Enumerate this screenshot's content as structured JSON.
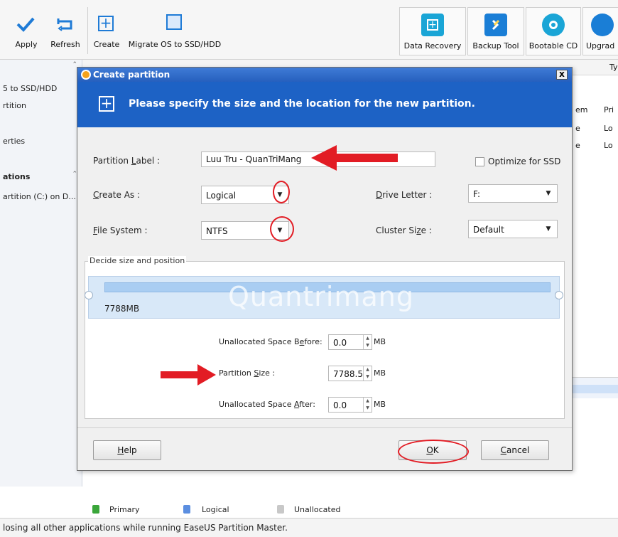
{
  "toolbar": {
    "apply": "Apply",
    "refresh": "Refresh",
    "create": "Create",
    "migrate": "Migrate OS to SSD/HDD",
    "data_recovery": "Data Recovery",
    "backup_tool": "Backup Tool",
    "bootable_cd": "Bootable CD",
    "upgrade": "Upgrad"
  },
  "sidebar": {
    "items": [
      {
        "label": "5 to SSD/HDD"
      },
      {
        "label": "rtition"
      },
      {
        "label": "erties"
      },
      {
        "label": "ations"
      },
      {
        "label": "artition (C:) on D..."
      }
    ]
  },
  "background_list": {
    "header_ty": "Ty",
    "col_em": "em",
    "rows": [
      {
        "a": "",
        "b": "Pri"
      },
      {
        "a": "e",
        "b": "Lo"
      },
      {
        "a": "e",
        "b": "Lo"
      }
    ]
  },
  "dialog": {
    "title": "Create partition",
    "close": "x",
    "header_text": "Please specify the size and the location for the new partition.",
    "partition_label": {
      "label_pre": "Partition ",
      "label_key": "L",
      "label_post": "abel :",
      "value": "Luu Tru - QuanTriMang"
    },
    "optimize_ssd": "Optimize for SSD",
    "create_as": {
      "label_pre": "",
      "label_key": "C",
      "label_post": "reate As :",
      "value": "Logical"
    },
    "drive_letter": {
      "label_pre": "",
      "label_key": "D",
      "label_post": "rive Letter :",
      "value": "F:"
    },
    "file_system": {
      "label_pre": "",
      "label_key": "F",
      "label_post": "ile System :",
      "value": "NTFS"
    },
    "cluster_size": {
      "label_pre": "Cluster Si",
      "label_key": "z",
      "label_post": "e :",
      "value": "Default"
    },
    "group_label": "Decide size and position",
    "bar_size_text": "7788MB",
    "watermark": "Quantrimang",
    "unalloc_before": {
      "label_pre": "Unallocated Space B",
      "label_key": "e",
      "label_post": "fore:",
      "value": "0.0",
      "unit": "MB"
    },
    "partition_size": {
      "label_pre": "Partition ",
      "label_key": "S",
      "label_post": "ize :",
      "value": "7788.5",
      "unit": "MB"
    },
    "unalloc_after": {
      "label_pre": "Unallocated Space ",
      "label_key": "A",
      "label_post": "fter:",
      "value": "0.0",
      "unit": "MB"
    },
    "help_btn": {
      "pre": "",
      "key": "H",
      "post": "elp"
    },
    "ok_btn": {
      "pre": "",
      "key": "O",
      "post": "K"
    },
    "cancel_btn": {
      "pre": "",
      "key": "C",
      "post": "ancel"
    }
  },
  "legend": {
    "primary": "Primary",
    "logical": "Logical",
    "unallocated": "Unallocated"
  },
  "status_bar": "losing all other applications while running EaseUS Partition Master.",
  "colors": {
    "accent_blue": "#1d62c5",
    "annotation_red": "#e21c24",
    "primary_green": "#3aa63a",
    "logical_blue": "#5b8ee0",
    "unallocated_gray": "#c8c8c8"
  }
}
